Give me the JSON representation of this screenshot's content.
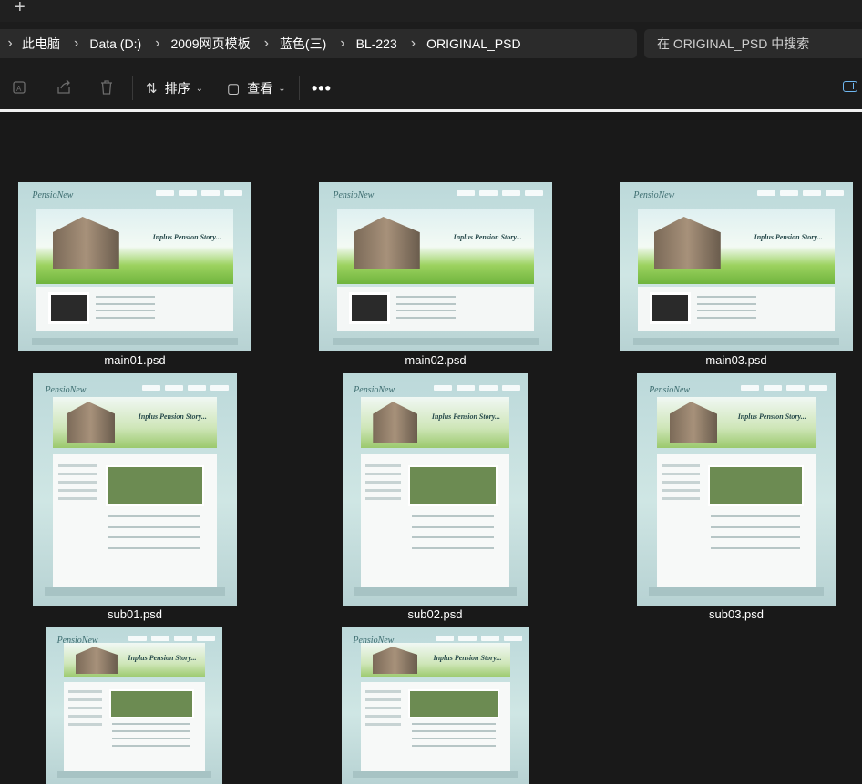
{
  "titlebar": {
    "new_tab": "+"
  },
  "breadcrumb": {
    "items": [
      "此电脑",
      "Data (D:)",
      "2009网页模板",
      "蓝色(三)",
      "BL-223",
      "ORIGINAL_PSD"
    ],
    "expander": "›",
    "separator": "›"
  },
  "search": {
    "placeholder": "在 ORIGINAL_PSD 中搜索"
  },
  "toolbar": {
    "sort_label": "排序",
    "view_label": "查看",
    "more_label": "•••",
    "sort_icon": "⇅",
    "view_icon": "▢",
    "caret": "⌄"
  },
  "files": [
    {
      "name": "main01.psd",
      "page_title": "PensioNew",
      "slogan": "Inplus Pension Story..."
    },
    {
      "name": "main02.psd",
      "page_title": "PensioNew",
      "slogan": "Inplus Pension Story..."
    },
    {
      "name": "main03.psd",
      "page_title": "PensioNew",
      "slogan": "Inplus Pension Story..."
    },
    {
      "name": "sub01.psd",
      "page_title": "PensioNew",
      "slogan": "Inplus Pension Story..."
    },
    {
      "name": "sub02.psd",
      "page_title": "PensioNew",
      "slogan": "Inplus Pension Story..."
    },
    {
      "name": "sub03.psd",
      "page_title": "PensioNew",
      "slogan": "Inplus Pension Story..."
    },
    {
      "name": "",
      "page_title": "PensioNew",
      "slogan": "Inplus Pension Story..."
    },
    {
      "name": "",
      "page_title": "PensioNew",
      "slogan": "Inplus Pension Story..."
    }
  ],
  "colors": {
    "background": "#191919",
    "accent": "#6fb7f0",
    "thumb_base": "#bcd9da"
  },
  "icons": [
    "rename-icon",
    "share-icon",
    "delete-icon",
    "sort-icon",
    "view-icon",
    "more-icon",
    "details-pane-icon"
  ]
}
